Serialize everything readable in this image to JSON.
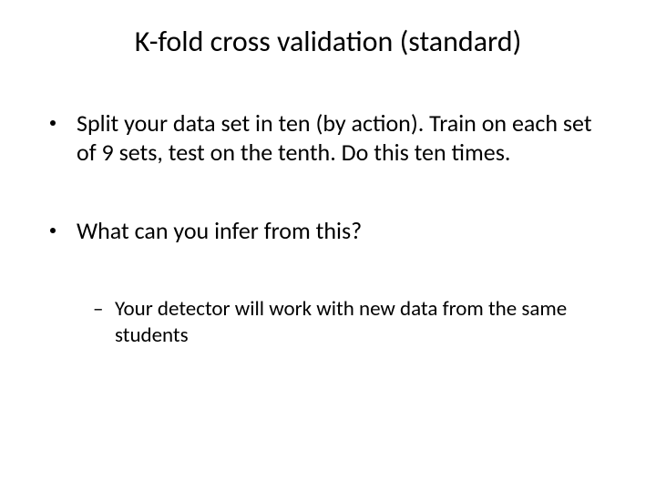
{
  "title": "K-fold cross validation (standard)",
  "bullets": [
    {
      "text": "Split your data set in ten (by action). Train on each set of 9 sets, test on the tenth. Do this ten times."
    },
    {
      "text": "What can you infer from this?",
      "sub": [
        "Your detector will work with new data from the same students"
      ]
    }
  ],
  "sub_dash": "–"
}
